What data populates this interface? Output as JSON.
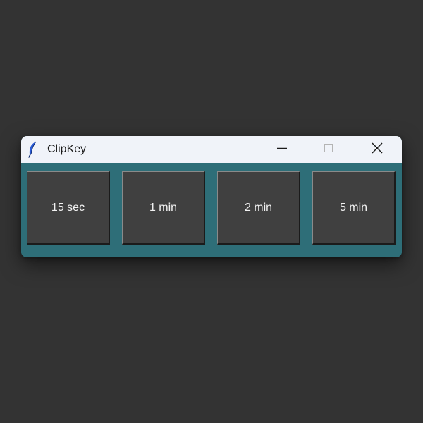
{
  "window": {
    "title": "ClipKey",
    "icon": "feather-icon",
    "controls": {
      "minimize": "minimize-icon",
      "maximize": "maximize-icon",
      "close": "close-icon"
    }
  },
  "buttons": [
    {
      "label": "15 sec"
    },
    {
      "label": "1 min"
    },
    {
      "label": "2 min"
    },
    {
      "label": "5 min"
    }
  ],
  "colors": {
    "desktop": "#333333",
    "titlebar": "#f0f3f9",
    "content_background": "#2e6e78",
    "button_background": "#404040",
    "button_text": "#f2f2f2"
  }
}
